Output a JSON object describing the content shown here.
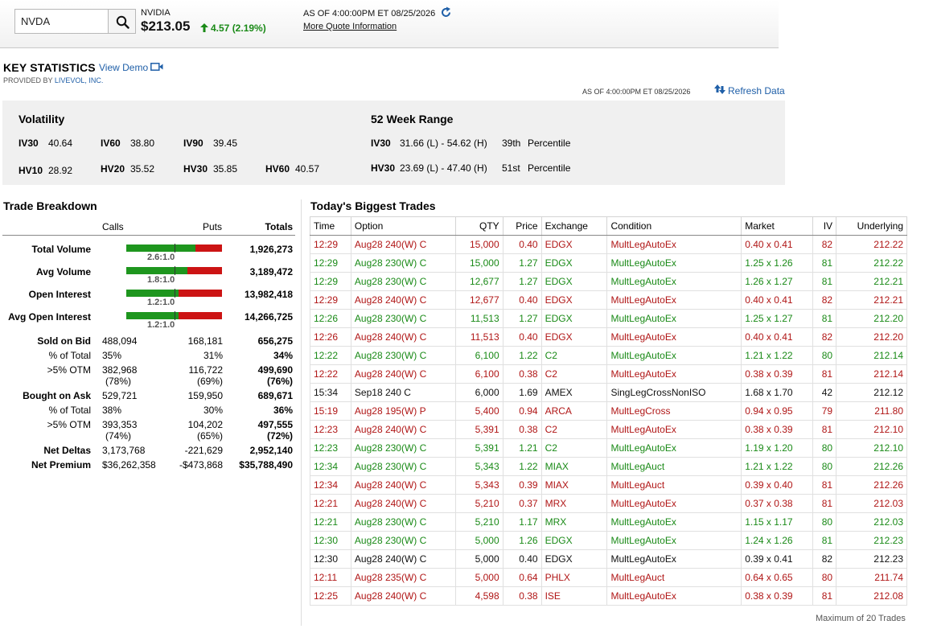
{
  "colors": {
    "up": "#1a8a17",
    "down": "#b01616",
    "neutral": "#111111",
    "link": "#1f5fa8"
  },
  "quote": {
    "symbol": "NVDA",
    "company": "NVIDIA",
    "price": "$213.05",
    "change": "4.57 (2.19%)",
    "as_of": "AS OF 4:00:00PM ET 08/25/2026",
    "more_info": "More Quote Information"
  },
  "key_stats": {
    "title": "KEY STATISTICS",
    "view_demo": "View Demo",
    "provided_by": "PROVIDED BY",
    "provider": "LIVEVOL, INC.",
    "as_of": "AS OF 4:00:00PM ET 08/25/2026",
    "refresh": "Refresh Data",
    "volatility": {
      "title": "Volatility",
      "iv": [
        {
          "label": "IV30",
          "value": "40.64"
        },
        {
          "label": "IV60",
          "value": "38.80"
        },
        {
          "label": "IV90",
          "value": "39.45"
        }
      ],
      "hv": [
        {
          "label": "HV10",
          "value": "28.92"
        },
        {
          "label": "HV20",
          "value": "35.52"
        },
        {
          "label": "HV30",
          "value": "35.85"
        },
        {
          "label": "HV60",
          "value": "40.57"
        }
      ]
    },
    "range52": {
      "title": "52 Week Range",
      "rows": [
        {
          "label": "IV30",
          "range": "31.66 (L) - 54.62 (H)",
          "pct": "39th",
          "pct_label": "Percentile"
        },
        {
          "label": "HV30",
          "range": "23.69 (L) - 47.40 (H)",
          "pct": "51st",
          "pct_label": "Percentile"
        }
      ]
    }
  },
  "trade_breakdown": {
    "title": "Trade Breakdown",
    "headers": {
      "calls": "Calls",
      "puts": "Puts",
      "totals": "Totals"
    },
    "bars": [
      {
        "label": "Total Volume",
        "calls_fraction": 0.72,
        "ratio": "2.6:1.0",
        "total": "1,926,273"
      },
      {
        "label": "Avg Volume",
        "calls_fraction": 0.64,
        "ratio": "1.8:1.0",
        "total": "3,189,472"
      },
      {
        "label": "Open Interest",
        "calls_fraction": 0.55,
        "ratio": "1.2:1.0",
        "total": "13,982,418"
      },
      {
        "label": "Avg Open Interest",
        "calls_fraction": 0.55,
        "ratio": "1.2:1.0",
        "total": "14,266,725"
      }
    ],
    "sold_on_bid": {
      "label": "Sold on Bid",
      "calls": "488,094",
      "puts": "168,181",
      "total": "656,275",
      "pct_label": "% of Total",
      "pct_calls": "35%",
      "pct_puts": "31%",
      "pct_total": "34%",
      "otm_label": ">5% OTM",
      "otm_calls": "382,968",
      "otm_puts": "116,722",
      "otm_total": "499,690",
      "otm_calls_pct": "(78%)",
      "otm_puts_pct": "(69%)",
      "otm_total_pct": "(76%)"
    },
    "bought_on_ask": {
      "label": "Bought on Ask",
      "calls": "529,721",
      "puts": "159,950",
      "total": "689,671",
      "pct_label": "% of Total",
      "pct_calls": "38%",
      "pct_puts": "30%",
      "pct_total": "36%",
      "otm_label": ">5% OTM",
      "otm_calls": "393,353",
      "otm_puts": "104,202",
      "otm_total": "497,555",
      "otm_calls_pct": "(74%)",
      "otm_puts_pct": "(65%)",
      "otm_total_pct": "(72%)"
    },
    "net_deltas": {
      "label": "Net Deltas",
      "calls": "3,173,768",
      "puts": "-221,629",
      "total": "2,952,140"
    },
    "net_premium": {
      "label": "Net Premium",
      "calls": "$36,262,358",
      "puts": "-$473,868",
      "total": "$35,788,490"
    }
  },
  "biggest_trades": {
    "title": "Today's Biggest Trades",
    "columns": [
      "Time",
      "Option",
      "QTY",
      "Price",
      "Exchange",
      "Condition",
      "Market",
      "IV",
      "Underlying"
    ],
    "rows": [
      {
        "time": "12:29",
        "option": "Aug28 240(W) C",
        "qty": "15,000",
        "price": "0.40",
        "exchange": "EDGX",
        "condition": "MultLegAutoEx",
        "market": "0.40 x 0.41",
        "iv": "82",
        "underlying": "212.22",
        "tone": "down"
      },
      {
        "time": "12:29",
        "option": "Aug28 230(W) C",
        "qty": "15,000",
        "price": "1.27",
        "exchange": "EDGX",
        "condition": "MultLegAutoEx",
        "market": "1.25 x 1.26",
        "iv": "81",
        "underlying": "212.22",
        "tone": "up"
      },
      {
        "time": "12:29",
        "option": "Aug28 230(W) C",
        "qty": "12,677",
        "price": "1.27",
        "exchange": "EDGX",
        "condition": "MultLegAutoEx",
        "market": "1.26 x 1.27",
        "iv": "81",
        "underlying": "212.21",
        "tone": "up"
      },
      {
        "time": "12:29",
        "option": "Aug28 240(W) C",
        "qty": "12,677",
        "price": "0.40",
        "exchange": "EDGX",
        "condition": "MultLegAutoEx",
        "market": "0.40 x 0.41",
        "iv": "82",
        "underlying": "212.21",
        "tone": "down"
      },
      {
        "time": "12:26",
        "option": "Aug28 230(W) C",
        "qty": "11,513",
        "price": "1.27",
        "exchange": "EDGX",
        "condition": "MultLegAutoEx",
        "market": "1.25 x 1.27",
        "iv": "81",
        "underlying": "212.20",
        "tone": "up"
      },
      {
        "time": "12:26",
        "option": "Aug28 240(W) C",
        "qty": "11,513",
        "price": "0.40",
        "exchange": "EDGX",
        "condition": "MultLegAutoEx",
        "market": "0.40 x 0.41",
        "iv": "82",
        "underlying": "212.20",
        "tone": "down"
      },
      {
        "time": "12:22",
        "option": "Aug28 230(W) C",
        "qty": "6,100",
        "price": "1.22",
        "exchange": "C2",
        "condition": "MultLegAutoEx",
        "market": "1.21 x 1.22",
        "iv": "80",
        "underlying": "212.14",
        "tone": "up"
      },
      {
        "time": "12:22",
        "option": "Aug28 240(W) C",
        "qty": "6,100",
        "price": "0.38",
        "exchange": "C2",
        "condition": "MultLegAutoEx",
        "market": "0.38 x 0.39",
        "iv": "81",
        "underlying": "212.14",
        "tone": "down"
      },
      {
        "time": "15:34",
        "option": "Sep18 240 C",
        "qty": "6,000",
        "price": "1.69",
        "exchange": "AMEX",
        "condition": "SingLegCrossNonISO",
        "market": "1.68 x 1.70",
        "iv": "42",
        "underlying": "212.12",
        "tone": "neutral"
      },
      {
        "time": "15:19",
        "option": "Aug28 195(W) P",
        "qty": "5,400",
        "price": "0.94",
        "exchange": "ARCA",
        "condition": "MultLegCross",
        "market": "0.94 x 0.95",
        "iv": "79",
        "underlying": "211.80",
        "tone": "down"
      },
      {
        "time": "12:23",
        "option": "Aug28 240(W) C",
        "qty": "5,391",
        "price": "0.38",
        "exchange": "C2",
        "condition": "MultLegAutoEx",
        "market": "0.38 x 0.39",
        "iv": "81",
        "underlying": "212.10",
        "tone": "down"
      },
      {
        "time": "12:23",
        "option": "Aug28 230(W) C",
        "qty": "5,391",
        "price": "1.21",
        "exchange": "C2",
        "condition": "MultLegAutoEx",
        "market": "1.19 x 1.20",
        "iv": "80",
        "underlying": "212.10",
        "tone": "up"
      },
      {
        "time": "12:34",
        "option": "Aug28 230(W) C",
        "qty": "5,343",
        "price": "1.22",
        "exchange": "MIAX",
        "condition": "MultLegAuct",
        "market": "1.21 x 1.22",
        "iv": "80",
        "underlying": "212.26",
        "tone": "up"
      },
      {
        "time": "12:34",
        "option": "Aug28 240(W) C",
        "qty": "5,343",
        "price": "0.39",
        "exchange": "MIAX",
        "condition": "MultLegAuct",
        "market": "0.39 x 0.40",
        "iv": "81",
        "underlying": "212.26",
        "tone": "down"
      },
      {
        "time": "12:21",
        "option": "Aug28 240(W) C",
        "qty": "5,210",
        "price": "0.37",
        "exchange": "MRX",
        "condition": "MultLegAutoEx",
        "market": "0.37 x 0.38",
        "iv": "81",
        "underlying": "212.03",
        "tone": "down"
      },
      {
        "time": "12:21",
        "option": "Aug28 230(W) C",
        "qty": "5,210",
        "price": "1.17",
        "exchange": "MRX",
        "condition": "MultLegAutoEx",
        "market": "1.15 x 1.17",
        "iv": "80",
        "underlying": "212.03",
        "tone": "up"
      },
      {
        "time": "12:30",
        "option": "Aug28 230(W) C",
        "qty": "5,000",
        "price": "1.26",
        "exchange": "EDGX",
        "condition": "MultLegAutoEx",
        "market": "1.24 x 1.26",
        "iv": "81",
        "underlying": "212.23",
        "tone": "up"
      },
      {
        "time": "12:30",
        "option": "Aug28 240(W) C",
        "qty": "5,000",
        "price": "0.40",
        "exchange": "EDGX",
        "condition": "MultLegAutoEx",
        "market": "0.39 x 0.41",
        "iv": "82",
        "underlying": "212.23",
        "tone": "neutral"
      },
      {
        "time": "12:11",
        "option": "Aug28 235(W) C",
        "qty": "5,000",
        "price": "0.64",
        "exchange": "PHLX",
        "condition": "MultLegAuct",
        "market": "0.64 x 0.65",
        "iv": "80",
        "underlying": "211.74",
        "tone": "down"
      },
      {
        "time": "12:25",
        "option": "Aug28 240(W) C",
        "qty": "4,598",
        "price": "0.38",
        "exchange": "ISE",
        "condition": "MultLegAutoEx",
        "market": "0.38 x 0.39",
        "iv": "81",
        "underlying": "212.08",
        "tone": "down"
      }
    ],
    "footer": "Maximum of 20 Trades"
  }
}
